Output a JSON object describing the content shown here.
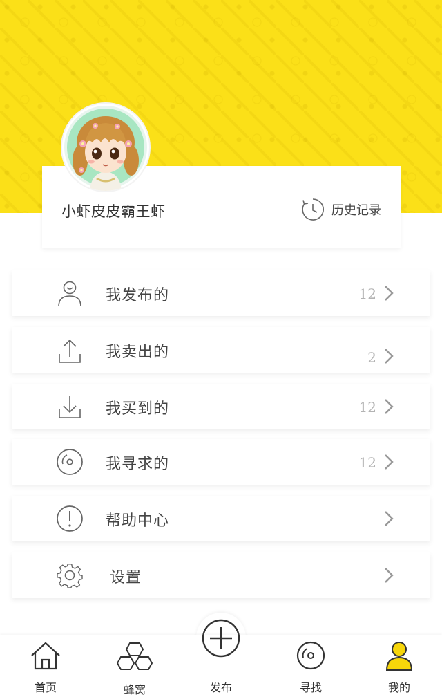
{
  "profile": {
    "username": "小虾皮皮霸王虾",
    "history_label": "历史记录",
    "avatar_icon": "cartoon-girl-avatar"
  },
  "menu": [
    {
      "label": "我发布的",
      "count": "12",
      "icon": "user-icon"
    },
    {
      "label": "我卖出的",
      "count": "2",
      "icon": "upload-icon"
    },
    {
      "label": "我买到的",
      "count": "12",
      "icon": "download-icon"
    },
    {
      "label": "我寻求的",
      "count": "12",
      "icon": "compass-icon"
    },
    {
      "label": "帮助中心",
      "count": "",
      "icon": "help-icon"
    },
    {
      "label": "设置",
      "count": "",
      "icon": "gear-icon"
    }
  ],
  "nav": [
    {
      "label": "首页",
      "icon": "home-icon"
    },
    {
      "label": "蜂窝",
      "icon": "hive-icon"
    },
    {
      "label": "发布",
      "icon": "plus-circle-icon"
    },
    {
      "label": "寻找",
      "icon": "compass-icon"
    },
    {
      "label": "我的",
      "icon": "user-icon",
      "active": true
    }
  ],
  "colors": {
    "accent": "#fbe018",
    "active_nav": "#f7d60a",
    "text": "#444444",
    "muted": "#b3b3b3"
  }
}
